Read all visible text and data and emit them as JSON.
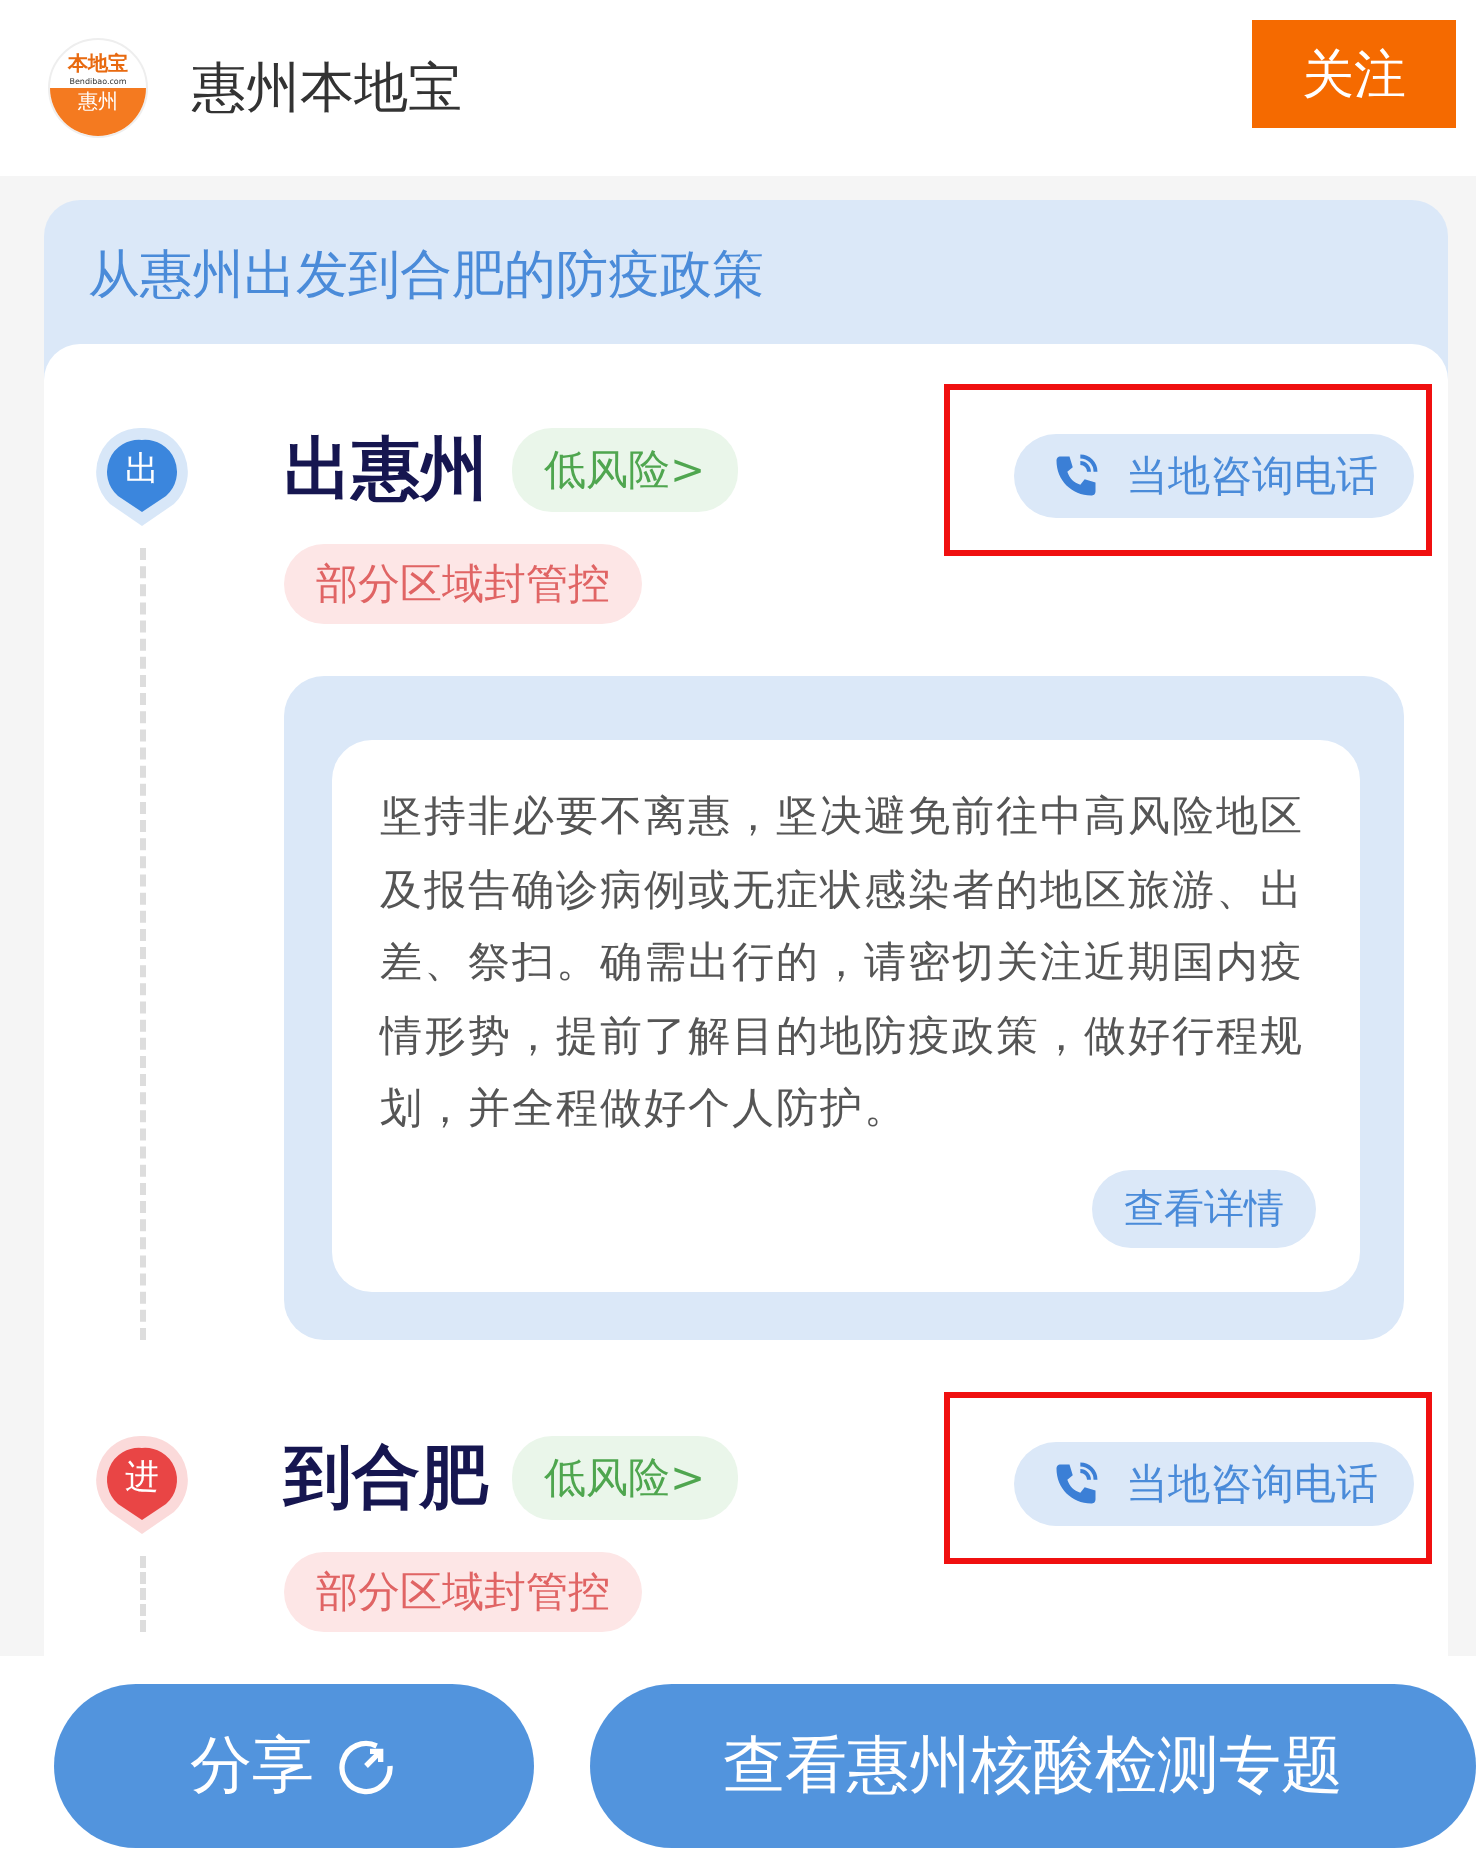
{
  "header": {
    "logo": {
      "top": "本地宝",
      "url": "Bendibao.com",
      "bottom": "惠州"
    },
    "title": "惠州本地宝",
    "follow_button": "关注"
  },
  "panel": {
    "title": "从惠州出发到合肥的防疫政策",
    "stages": [
      {
        "pin": "出",
        "color": "#3b86dd",
        "name": "出惠州",
        "risk": "低风险>",
        "phone_button": "当地咨询电话",
        "highlighted": true,
        "tag": "部分区域封管控",
        "detail": {
          "text": "坚持非必要不离惠，坚决避免前往中高风险地区及报告确诊病例或无症状感染者的地区旅游、出差、祭扫。确需出行的，请密切关注近期国内疫情形势，提前了解目的地防疫政策，做好行程规划，并全程做好个人防护。",
          "button": "查看详情"
        }
      },
      {
        "pin": "进",
        "color": "#e94545",
        "name": "到合肥",
        "risk": "低风险>",
        "phone_button": "当地咨询电话",
        "highlighted": true,
        "tag": "部分区域封管控"
      }
    ]
  },
  "bottom_bar": {
    "share_button": "分享",
    "topic_button": "查看惠州核酸检测专题"
  }
}
